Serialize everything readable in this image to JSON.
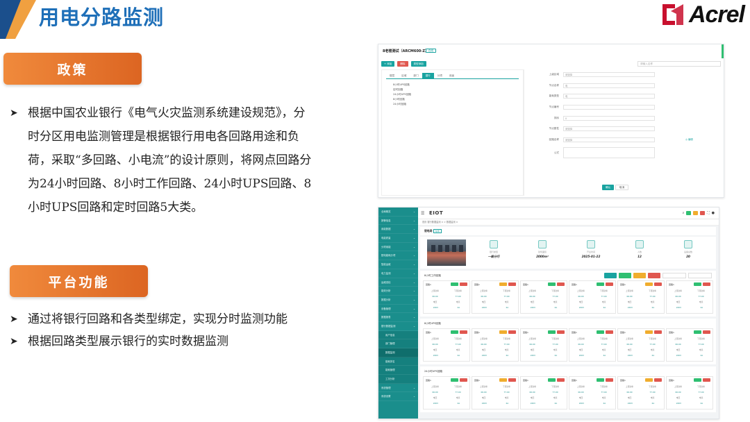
{
  "slide": {
    "title": "用电分路监测",
    "brand": "Acrel",
    "colors": {
      "title_blue": "#1e6fb8",
      "pill_orange": "#e8752c",
      "teal": "#19a3a0"
    }
  },
  "policy": {
    "heading": "政策",
    "bullets": [
      "根据中国农业银行《电气火灾监测系统建设规范》，分时分区用电监测管理是根据银行用电各回路用途和负荷，采取“多回路、小电流”的设计原则，将网点回路分为24小时回路、8小时工作回路、24小时UPS回路、8小时UPS回路和定时回路5大类。"
    ]
  },
  "platform": {
    "heading": "平台功能",
    "bullets": [
      "通过将银行回路和各类型绑定，实现分时监测功能",
      "根据回路类型展示银行的实时数据监测"
    ]
  },
  "form_screen": {
    "title": "8老楼测试（ARCM600-Z）",
    "badge": "在线",
    "toolbar": [
      "+ 添加",
      "删除",
      "类型添加"
    ],
    "search_placeholder": "请输入名称",
    "tabs": [
      "楼层",
      "区域",
      "部门",
      "银行",
      "分项",
      "用途"
    ],
    "active_tab": "银行",
    "tree": [
      "8小时UPS回路",
      "定时回路",
      "24小时UPS回路",
      "8小时回路",
      "24小时回路"
    ],
    "fields": [
      {
        "label": "上级区域",
        "value": "请选择"
      },
      {
        "label": "节点名称",
        "value": "电"
      },
      {
        "label": "能耗类型",
        "value": "电"
      },
      {
        "label": "节点编号",
        "value": ""
      },
      {
        "label": "排序",
        "value": "0"
      },
      {
        "label": "节点属性",
        "value": "请选择"
      },
      {
        "label": "回路名称",
        "value": "请选择"
      },
      {
        "label": "公式",
        "value": ""
      }
    ],
    "side_link": "◎ 编辑",
    "ok": "确认",
    "cancel": "取消"
  },
  "dashboard": {
    "logo": "EIOT",
    "crumbs": "首页  银行数据监测 ×  > 数据监测 ×",
    "nav": [
      {
        "label": "全局概览",
        "sub": false
      },
      {
        "label": "报警信息",
        "sub": false
      },
      {
        "label": "用能数据",
        "sub": false
      },
      {
        "label": "电能质量",
        "sub": false
      },
      {
        "label": "分项用能",
        "sub": false
      },
      {
        "label": "配电能耗分项",
        "sub": false
      },
      {
        "label": "智能运维",
        "sub": false
      },
      {
        "label": "电力监测",
        "sub": false
      },
      {
        "label": "运维巡检",
        "sub": false
      },
      {
        "label": "能效分析",
        "sub": false
      },
      {
        "label": "数据分析",
        "sub": false
      },
      {
        "label": "设备管理",
        "sub": false
      },
      {
        "label": "数据报表",
        "sub": false
      },
      {
        "label": "银行数据监测",
        "sub": false
      },
      {
        "label": "用户信息",
        "sub": true
      },
      {
        "label": "部门管理",
        "sub": true
      },
      {
        "label": "数据监测",
        "sub": true,
        "selected": true
      },
      {
        "label": "能耗排名",
        "sub": true
      },
      {
        "label": "能耗管理",
        "sub": true
      },
      {
        "label": "工况分析",
        "sub": true
      },
      {
        "label": "系统管理",
        "sub": false
      },
      {
        "label": "系统设置",
        "sub": false
      }
    ],
    "page_title": "银电网",
    "page_badge": "在线",
    "stats": [
      {
        "label": "银行类型",
        "value": "一级分行"
      },
      {
        "label": "建筑面积",
        "value": "2000m²"
      },
      {
        "label": "开业时间",
        "value": "2025-01-22"
      },
      {
        "label": "人数",
        "value": "12"
      },
      {
        "label": "设备总数",
        "value": "20"
      }
    ],
    "groups": [
      {
        "title": "8小时工作回路"
      },
      {
        "title": "8小时UPS回路"
      },
      {
        "title": "24小时UPS回路"
      }
    ],
    "card": {
      "name": "回路1",
      "rows": [
        [
          "上限功率",
          "下限功率"
        ],
        [
          "06.00",
          "77.00"
        ],
        [
          "电压",
          "电流"
        ],
        [
          "220V",
          "2A"
        ]
      ]
    }
  }
}
